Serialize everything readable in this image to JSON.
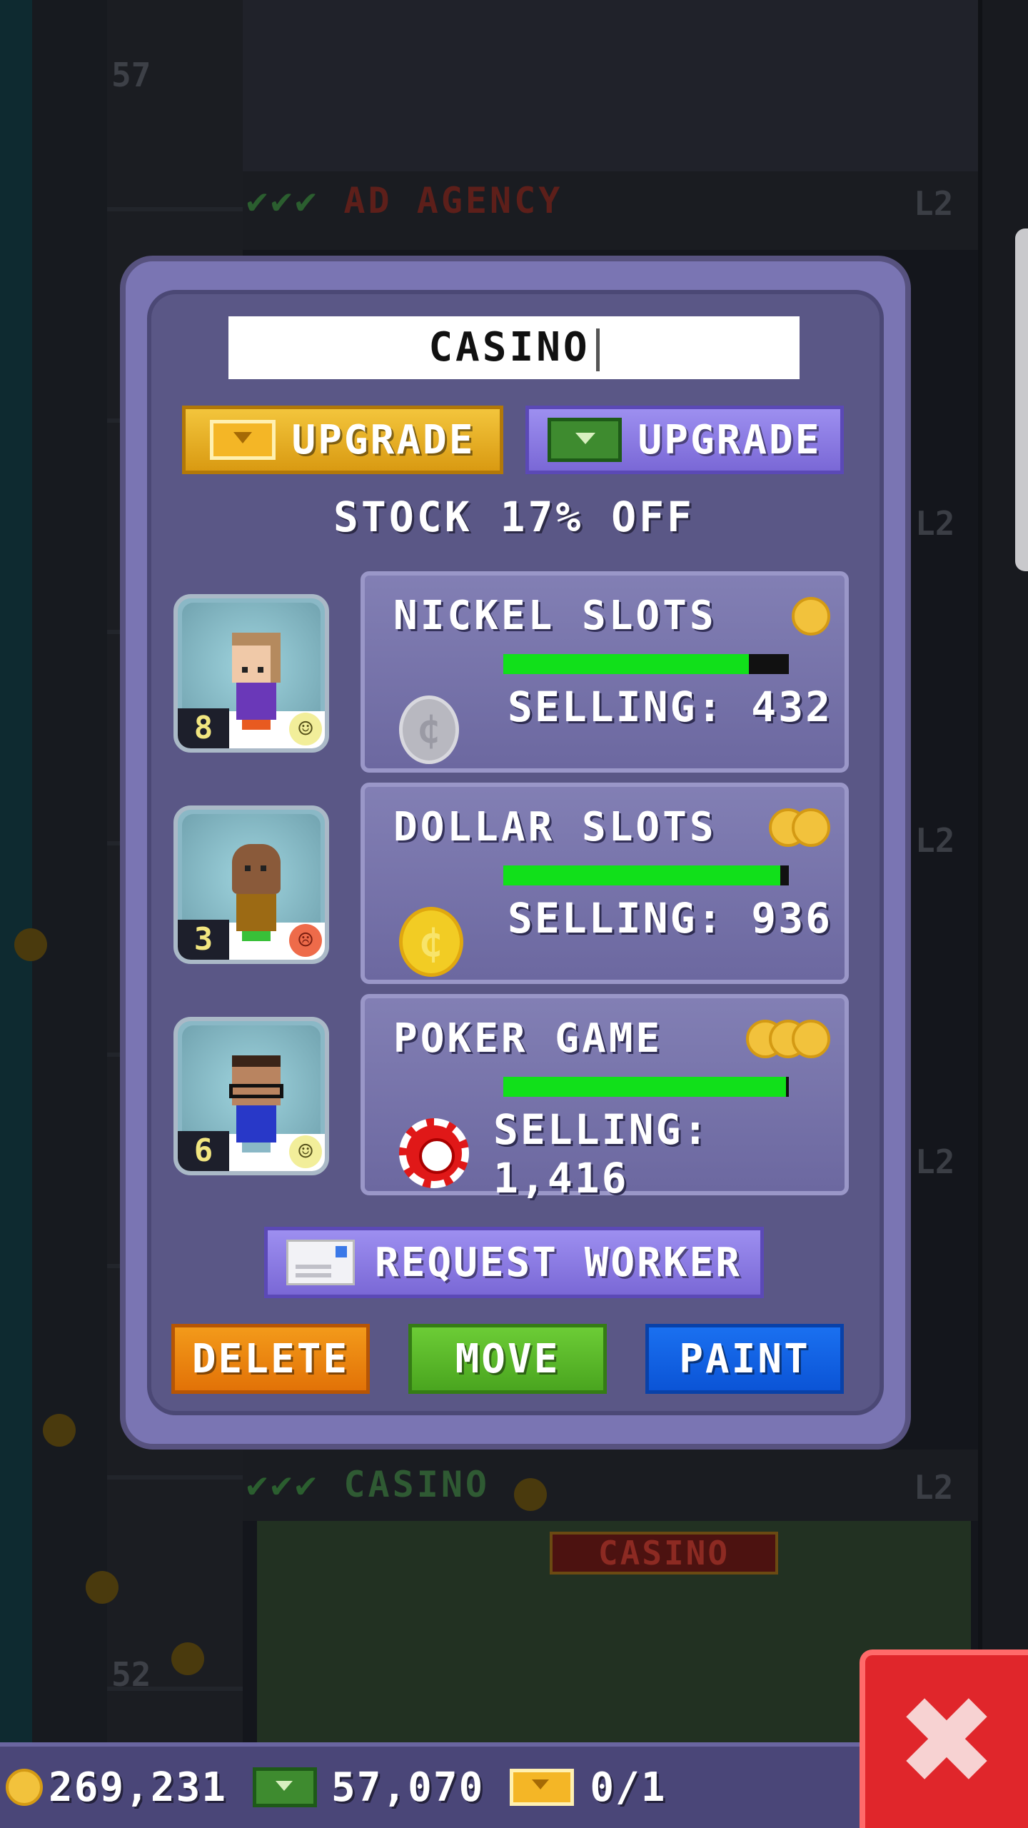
{
  "background": {
    "floor_numbers": [
      "57",
      "52"
    ],
    "floors": [
      {
        "checks": "✔✔✔",
        "name": "AD AGENCY",
        "level": "L2"
      },
      {
        "checks": "✔✔✔",
        "name": "CASINO",
        "level": "L2"
      }
    ],
    "side_levels": [
      "L2",
      "L2",
      "L2",
      "L2"
    ],
    "casino_sign": "CASINO"
  },
  "dialog": {
    "name_field_value": "CASINO",
    "upgrade_tickets_label": "UPGRADE",
    "upgrade_bux_label": "UPGRADE",
    "stock_text": "STOCK 17% OFF",
    "workers": [
      {
        "count": "8",
        "mood": "happy",
        "mood_icon": "☺"
      },
      {
        "count": "3",
        "mood": "unhappy",
        "mood_icon": "☹"
      },
      {
        "count": "6",
        "mood": "happy",
        "mood_icon": "☺"
      }
    ],
    "products": [
      {
        "name": "NICKEL SLOTS",
        "selling": "SELLING: 432",
        "tier": 1,
        "stock_fraction": 0.86,
        "icon": "silver-coin-icon"
      },
      {
        "name": "DOLLAR SLOTS",
        "selling": "SELLING: 936",
        "tier": 2,
        "stock_fraction": 0.97,
        "icon": "gold-coin-icon"
      },
      {
        "name": "POKER GAME",
        "selling": "SELLING: 1,416",
        "tier": 3,
        "stock_fraction": 0.99,
        "icon": "poker-chip-icon"
      }
    ],
    "coin_glyph": "¢",
    "request_worker_label": "REQUEST WORKER",
    "delete_label": "DELETE",
    "move_label": "MOVE",
    "paint_label": "PAINT"
  },
  "statusbar": {
    "coins": "269,231",
    "bux": "57,070",
    "tickets": "0/1"
  },
  "close_glyph": "✖",
  "colors": {
    "dialog": "#5a5786",
    "stock_bar": "#11e01a",
    "delete": "#e27207",
    "move": "#4aa51f",
    "paint": "#0b54d6",
    "close": "#e0262b"
  }
}
